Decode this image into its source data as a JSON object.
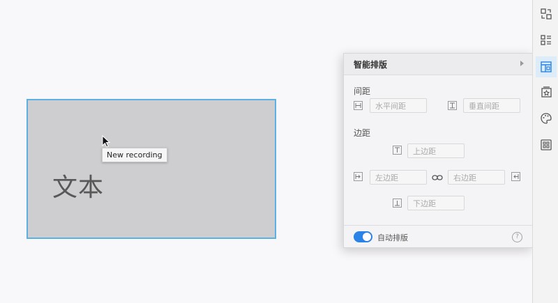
{
  "canvas": {
    "frame_text": "文本",
    "tooltip": "New recording"
  },
  "toolbar": {
    "items": [
      {
        "icon": "swap-icon"
      },
      {
        "icon": "list-icon"
      },
      {
        "icon": "layout-icon",
        "active": true
      },
      {
        "icon": "star-frame-icon"
      },
      {
        "icon": "palette-icon"
      },
      {
        "icon": "grid-icon"
      }
    ]
  },
  "panel": {
    "title": "智能排版",
    "spacing": {
      "label": "间距",
      "horizontal_placeholder": "水平间距",
      "vertical_placeholder": "垂直间距"
    },
    "margin": {
      "label": "边距",
      "top_placeholder": "上边距",
      "left_placeholder": "左边距",
      "right_placeholder": "右边距",
      "bottom_placeholder": "下边距"
    },
    "auto_layout": {
      "label": "自动排版",
      "enabled": true
    },
    "help": "?"
  },
  "colors": {
    "accent": "#2a83e6",
    "selection_border": "#5bb0e4",
    "frame_fill": "#cecdcf"
  }
}
